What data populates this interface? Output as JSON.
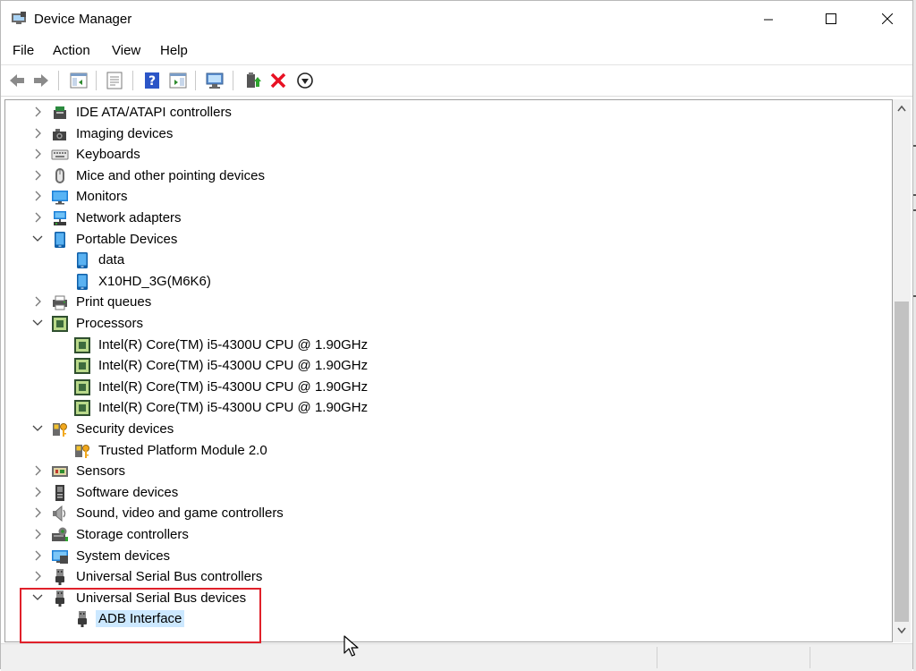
{
  "window": {
    "title": "Device Manager",
    "controls": {
      "minimize": "minimize",
      "maximize": "maximize",
      "close": "close"
    }
  },
  "menu": [
    "File",
    "Action",
    "View",
    "Help"
  ],
  "toolbar": {
    "buttons": [
      "back-arrow-icon",
      "forward-arrow-icon",
      "show-hide-console-tree-icon",
      "properties-icon",
      "help-icon",
      "action-pane-icon",
      "scan-hardware-icon",
      "update-driver-icon",
      "uninstall-device-icon",
      "disable-device-icon"
    ]
  },
  "tree": [
    {
      "label": "IDE ATA/ATAPI controllers",
      "level": 1,
      "expanded": false,
      "icon": "ide-controller-icon"
    },
    {
      "label": "Imaging devices",
      "level": 1,
      "expanded": false,
      "icon": "camera-icon"
    },
    {
      "label": "Keyboards",
      "level": 1,
      "expanded": false,
      "icon": "keyboard-icon"
    },
    {
      "label": "Mice and other pointing devices",
      "level": 1,
      "expanded": false,
      "icon": "mouse-icon"
    },
    {
      "label": "Monitors",
      "level": 1,
      "expanded": false,
      "icon": "monitor-icon"
    },
    {
      "label": "Network adapters",
      "level": 1,
      "expanded": false,
      "icon": "network-icon"
    },
    {
      "label": "Portable Devices",
      "level": 1,
      "expanded": true,
      "icon": "portable-device-icon"
    },
    {
      "label": "data",
      "level": 2,
      "icon": "portable-device-icon"
    },
    {
      "label": "X10HD_3G(M6K6)",
      "level": 2,
      "icon": "portable-device-icon"
    },
    {
      "label": "Print queues",
      "level": 1,
      "expanded": false,
      "icon": "printer-icon"
    },
    {
      "label": "Processors",
      "level": 1,
      "expanded": true,
      "icon": "processor-icon"
    },
    {
      "label": "Intel(R) Core(TM) i5-4300U CPU @ 1.90GHz",
      "level": 2,
      "icon": "processor-icon"
    },
    {
      "label": "Intel(R) Core(TM) i5-4300U CPU @ 1.90GHz",
      "level": 2,
      "icon": "processor-icon"
    },
    {
      "label": "Intel(R) Core(TM) i5-4300U CPU @ 1.90GHz",
      "level": 2,
      "icon": "processor-icon"
    },
    {
      "label": "Intel(R) Core(TM) i5-4300U CPU @ 1.90GHz",
      "level": 2,
      "icon": "processor-icon"
    },
    {
      "label": "Security devices",
      "level": 1,
      "expanded": true,
      "icon": "security-key-icon"
    },
    {
      "label": "Trusted Platform Module 2.0",
      "level": 2,
      "icon": "security-key-icon"
    },
    {
      "label": "Sensors",
      "level": 1,
      "expanded": false,
      "icon": "sensor-icon"
    },
    {
      "label": "Software devices",
      "level": 1,
      "expanded": false,
      "icon": "software-device-icon"
    },
    {
      "label": "Sound, video and game controllers",
      "level": 1,
      "expanded": false,
      "icon": "speaker-icon"
    },
    {
      "label": "Storage controllers",
      "level": 1,
      "expanded": false,
      "icon": "storage-icon"
    },
    {
      "label": "System devices",
      "level": 1,
      "expanded": false,
      "icon": "system-device-icon"
    },
    {
      "label": "Universal Serial Bus controllers",
      "level": 1,
      "expanded": false,
      "icon": "usb-icon"
    },
    {
      "label": "Universal Serial Bus devices",
      "level": 1,
      "expanded": true,
      "icon": "usb-icon"
    },
    {
      "label": "ADB Interface",
      "level": 2,
      "icon": "usb-icon",
      "selected": true
    }
  ],
  "colors": {
    "selection": "#cce8ff",
    "highlight_box": "#e0202a",
    "uninstall_x": "#e81123"
  }
}
